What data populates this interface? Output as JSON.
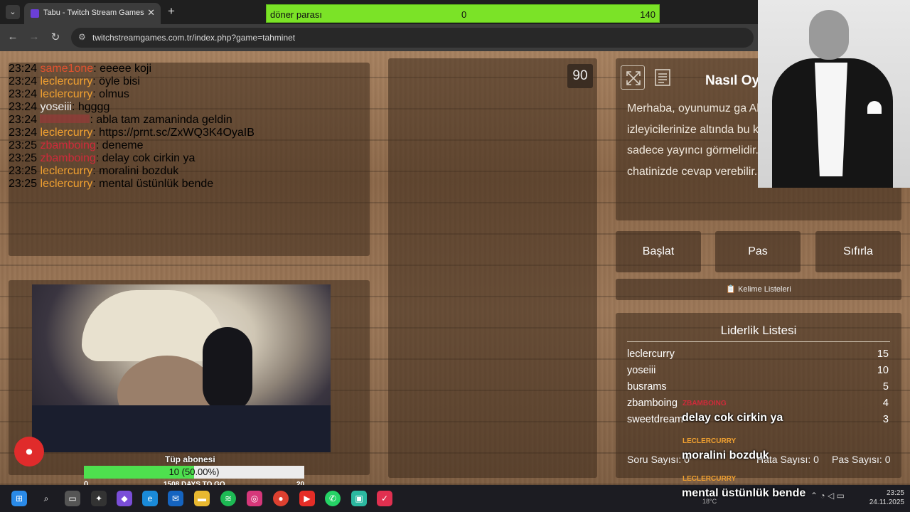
{
  "browser": {
    "tab_title": "Tabu - Twitch Stream Games",
    "tab_close": "✕",
    "new_tab": "+",
    "url": "twitchstreamgames.com.tr/index.php?game=tahminet",
    "back": "←",
    "forward": "→",
    "reload": "↻"
  },
  "doner": {
    "label": "döner parası",
    "current": "0",
    "target": "140",
    "progress": 0.0
  },
  "chat": [
    {
      "time": "23:24",
      "user": "same1one",
      "color": "#e0522f",
      "text": ": eeeee koji"
    },
    {
      "time": "23:24",
      "user": "leclercurry",
      "color": "#f0a030",
      "text": ": öyle bisi"
    },
    {
      "time": "23:24",
      "user": "leclercurry",
      "color": "#f0a030",
      "text": ": olmus"
    },
    {
      "time": "23:24",
      "user": "yoseiii",
      "color": "#f1f1f1",
      "text": ": hgggg"
    },
    {
      "time": "23:24",
      "user": "",
      "color": "#c8283c",
      "text": ": abla tam zamaninda geldin"
    },
    {
      "time": "23:24",
      "user": "leclercurry",
      "color": "#f0a030",
      "text": ": https://prnt.sc/ZxWQ3K4OyaIB"
    },
    {
      "time": "23:25",
      "user": "zbamboing",
      "color": "#d02a3a",
      "text": ": deneme"
    },
    {
      "time": "23:25",
      "user": "zbamboing",
      "color": "#d02a3a",
      "text": ": delay cok cirkin ya"
    },
    {
      "time": "23:25",
      "user": "leclercurry",
      "color": "#f0a030",
      "text": ": moralini bozduk"
    },
    {
      "time": "23:25",
      "user": "leclercurry",
      "color": "#f0a030",
      "text": ": mental üstünlük bende"
    }
  ],
  "timer": "90",
  "howto": {
    "title": "Nasıl Oy",
    "text": "Merhaba, oyunumuz ga Alanı- olan sol altta ki bö izleyicilerinize altında bu kullanmadan anlatmaya sadece yayıncı görmelidir. izleyicileriniz yayın chatinizde cevap verebilir."
  },
  "buttons": {
    "start": "Başlat",
    "pass": "Pas",
    "reset": "Sıfırla",
    "wordlists": "📋 Kelime Listeleri"
  },
  "leaderboard": {
    "title": "Liderlik Listesi",
    "rows": [
      {
        "name": "leclercurry",
        "score": "15"
      },
      {
        "name": "yoseiii",
        "score": "10"
      },
      {
        "name": "busrams",
        "score": "5"
      },
      {
        "name": "zbamboing",
        "score": "4"
      },
      {
        "name": "sweetdream",
        "score": "3"
      }
    ]
  },
  "stats": {
    "questions": "Soru Sayısı: 0",
    "errors": "Hata Sayısı: 0",
    "passes": "Pas Sayısı: 0"
  },
  "sub_goal": {
    "title": "Tüp abonesi",
    "text": "10 (50.00%)",
    "progress": 0.5,
    "min": "0",
    "days": "1508 DAYS TO GO",
    "max": "20"
  },
  "chat_overlay": [
    {
      "user": "ZBAMBOING",
      "color": "#d02a3a",
      "text": "delay cok cirkin ya"
    },
    {
      "user": "LECLERCURRY",
      "color": "#f0a030",
      "text": "moralini bozduk"
    },
    {
      "user": "LECLERCURRY",
      "color": "#f0a030",
      "text": "mental üstünlük bende"
    }
  ],
  "taskbar": {
    "weather": "18°C",
    "time": "23:25",
    "date": "24.11.2025"
  }
}
